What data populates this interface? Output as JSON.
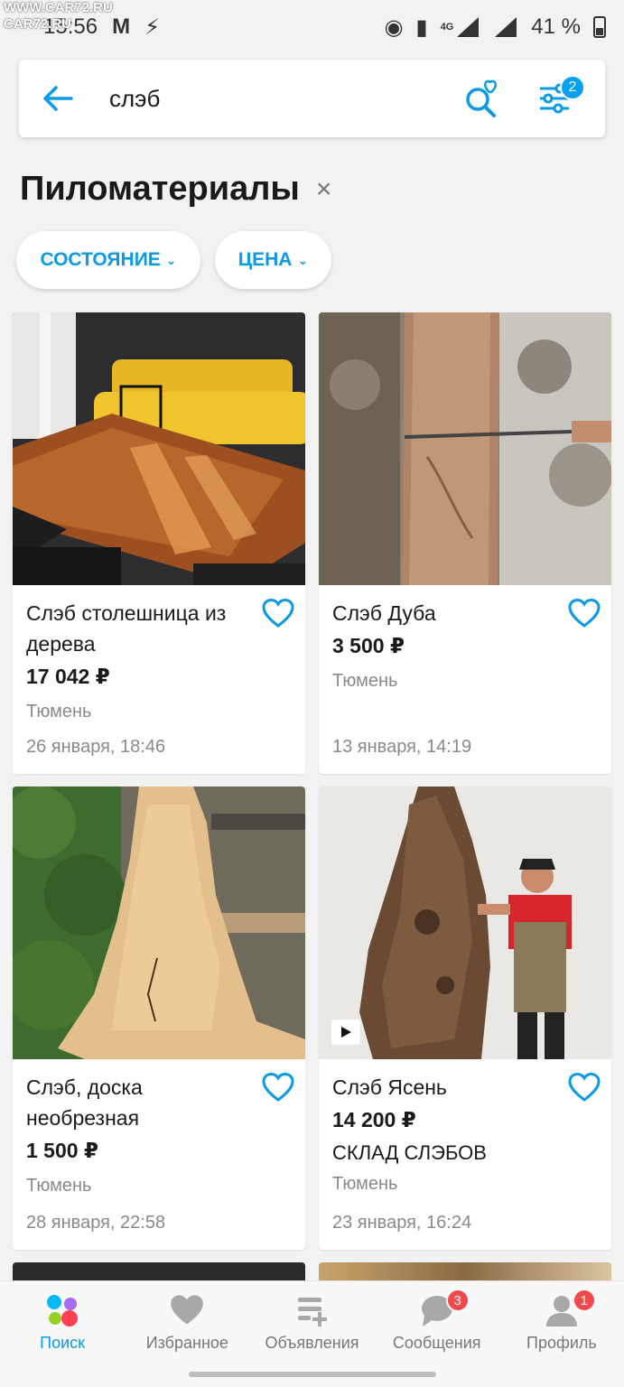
{
  "status_bar": {
    "time": "15:56",
    "watermark_top": "WWW.CAR72.RU",
    "watermark_bottom": "CAR72.RU",
    "network": "4G",
    "battery": "41 %"
  },
  "search": {
    "query": "слэб",
    "filter_count": "2"
  },
  "category": {
    "title": "Пиломатериалы",
    "close": "×"
  },
  "chips": [
    {
      "label": "СОСТОЯНИЕ"
    },
    {
      "label": "ЦЕНА"
    }
  ],
  "listings": [
    {
      "title": "Слэб столешница из дерева",
      "price": "17 042 ₽",
      "seller": "",
      "city": "Тюмень",
      "date": "26 января, 18:46"
    },
    {
      "title": "Слэб Дуба",
      "price": "3 500 ₽",
      "seller": "",
      "city": "Тюмень",
      "date": "13 января, 14:19"
    },
    {
      "title": "Слэб, доска необрезная",
      "price": "1 500 ₽",
      "seller": "",
      "city": "Тюмень",
      "date": "28 января, 22:58"
    },
    {
      "title": "Слэб Ясень",
      "price": "14 200 ₽",
      "seller": "СКЛАД СЛЭБОВ",
      "city": "Тюмень",
      "date": "23 января, 16:24"
    }
  ],
  "bottom_nav": [
    {
      "label": "Поиск",
      "badge": ""
    },
    {
      "label": "Избранное",
      "badge": ""
    },
    {
      "label": "Объявления",
      "badge": ""
    },
    {
      "label": "Сообщения",
      "badge": "3"
    },
    {
      "label": "Профиль",
      "badge": "1"
    }
  ],
  "colors": {
    "accent": "#0a9ae6",
    "badge_red": "#f24a4a",
    "muted_text": "#8a8a8a"
  }
}
